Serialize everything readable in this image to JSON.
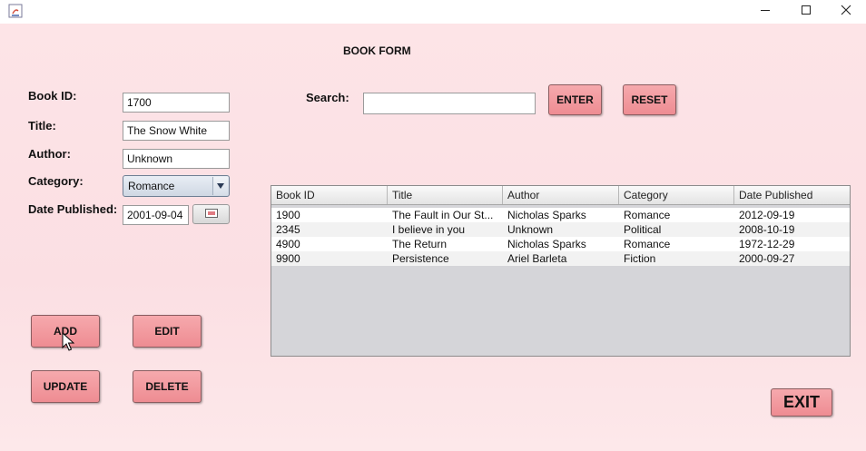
{
  "form": {
    "title": "BOOK FORM",
    "book_id_label": "Book ID:",
    "book_id_value": "1700",
    "title_label": "Title:",
    "title_value": "The Snow White",
    "author_label": "Author:",
    "author_value": "Unknown",
    "category_label": "Category:",
    "category_value": "Romance",
    "date_label": "Date Published:",
    "date_value": "2001-09-04"
  },
  "search": {
    "label": "Search:",
    "value": "",
    "enter_label": "ENTER",
    "reset_label": "RESET"
  },
  "actions": {
    "add_label": "ADD",
    "edit_label": "EDIT",
    "update_label": "UPDATE",
    "delete_label": "DELETE",
    "exit_label": "EXIT"
  },
  "table": {
    "columns": [
      "Book ID",
      "Title",
      "Author",
      "Category",
      "Date Published"
    ],
    "rows": [
      [
        "1900",
        "The Fault in Our St...",
        "Nicholas Sparks",
        "Romance",
        "2012-09-19"
      ],
      [
        "2345",
        "I believe in you",
        "Unknown",
        "Political",
        "2008-10-19"
      ],
      [
        "4900",
        "The Return",
        "Nicholas Sparks",
        "Romance",
        "1972-12-29"
      ],
      [
        "9900",
        "Persistence",
        "Ariel Barleta",
        "Fiction",
        "2000-09-27"
      ]
    ]
  },
  "icons": {
    "app": "java-app-icon",
    "minimize": "minimize-icon",
    "maximize": "maximize-icon",
    "close": "close-icon",
    "dropdown": "chevron-down-icon",
    "calendar": "calendar-icon",
    "cursor": "mouse-pointer-icon"
  },
  "colors": {
    "background": "#fbe3e6",
    "button": "#f19aa0",
    "table_alt_row": "#f2f2f2"
  }
}
